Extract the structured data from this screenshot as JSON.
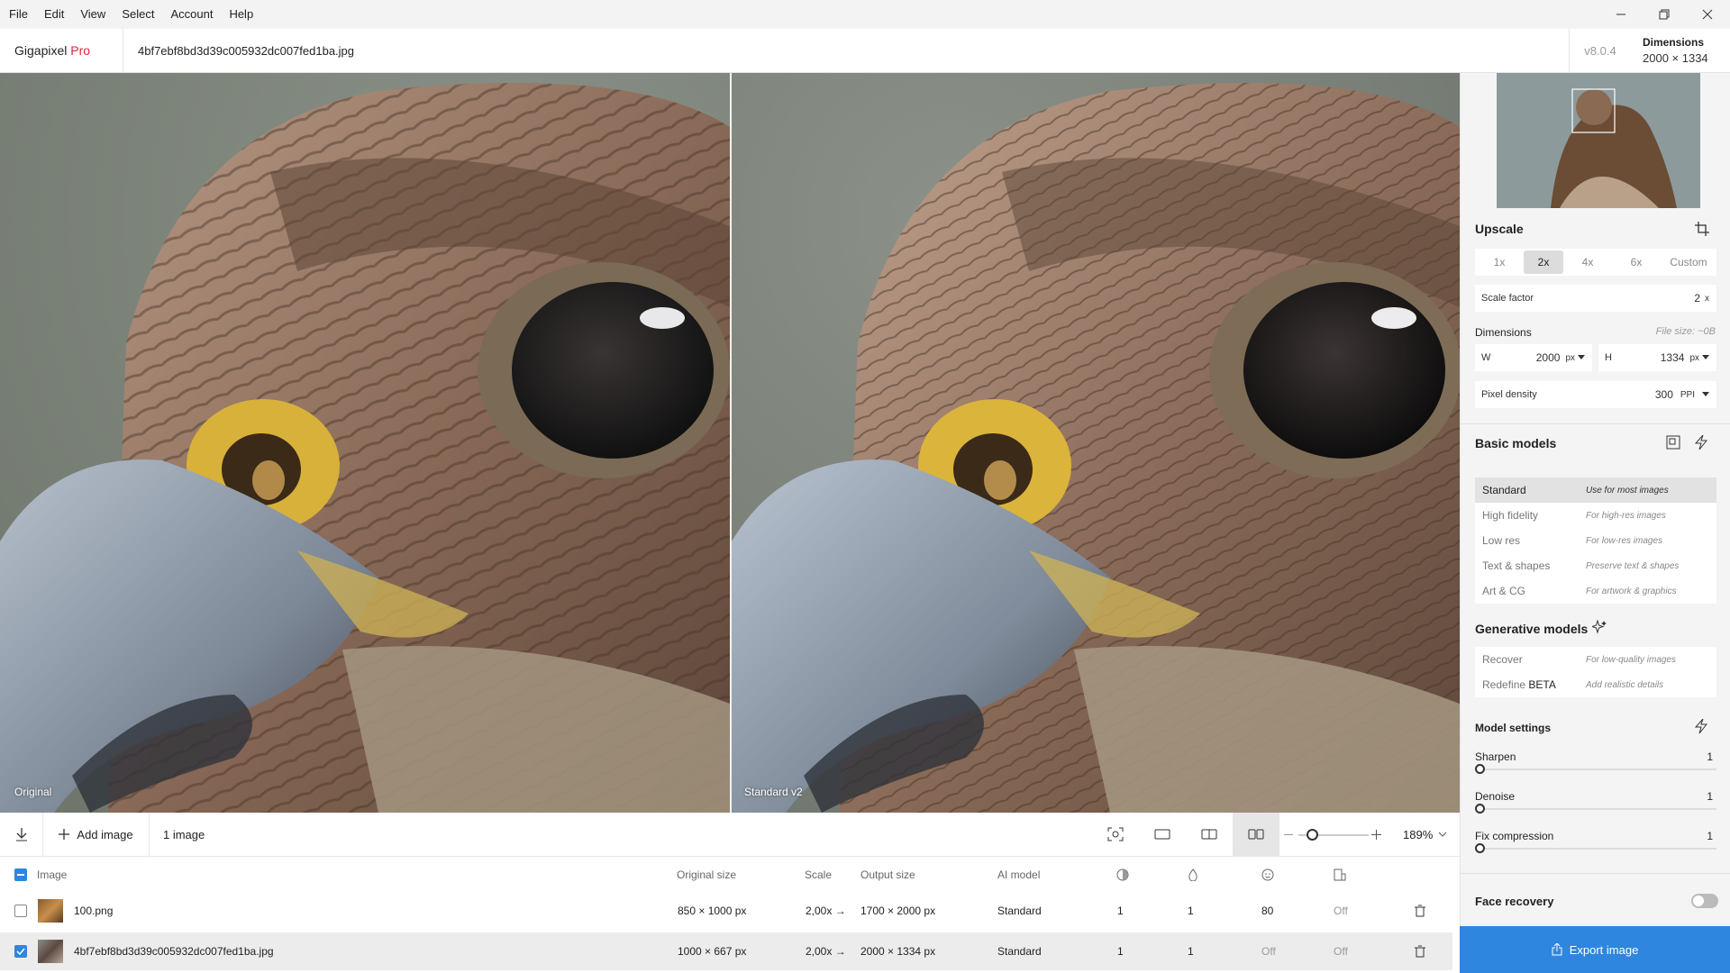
{
  "menu": [
    "File",
    "Edit",
    "View",
    "Select",
    "Account",
    "Help"
  ],
  "app": {
    "name": "Gigapixel",
    "edition": "Pro",
    "file": "4bf7ebf8bd3d39c005932dc007fed1ba.jpg",
    "version": "v8.0.4",
    "dims_label": "Dimensions",
    "dims_value": "2000 × 1334"
  },
  "canvas": {
    "left_label": "Original",
    "right_label": "Standard v2"
  },
  "toolbar": {
    "add_image": "Add image",
    "count": "1 image",
    "zoom": "189%"
  },
  "upscale": {
    "title": "Upscale",
    "options": [
      "1x",
      "2x",
      "4x",
      "6x",
      "Custom"
    ],
    "selected": "2x",
    "scale_label": "Scale factor",
    "scale_value": "2",
    "scale_unit": "x",
    "dims_label": "Dimensions",
    "file_size": "File size: ~0B",
    "w_label": "W",
    "w_value": "2000",
    "w_unit": "px",
    "h_label": "H",
    "h_value": "1334",
    "h_unit": "px",
    "density_label": "Pixel density",
    "density_value": "300",
    "density_unit": "PPI"
  },
  "basic_models": {
    "title": "Basic models",
    "items": [
      {
        "name": "Standard",
        "desc": "Use for most images"
      },
      {
        "name": "High fidelity",
        "desc": "For high-res images"
      },
      {
        "name": "Low res",
        "desc": "For low-res images"
      },
      {
        "name": "Text & shapes",
        "desc": "Preserve text & shapes"
      },
      {
        "name": "Art & CG",
        "desc": "For artwork & graphics"
      }
    ],
    "selected": "Standard"
  },
  "generative_models": {
    "title": "Generative models",
    "items": [
      {
        "name": "Recover",
        "desc": "For low-quality images"
      },
      {
        "name": "Redefine",
        "badge": "BETA",
        "desc": "Add realistic details"
      }
    ]
  },
  "model_settings": {
    "title": "Model settings",
    "sliders": [
      {
        "label": "Sharpen",
        "value": "1",
        "level": 0
      },
      {
        "label": "Denoise",
        "value": "1",
        "level": 0
      },
      {
        "label": "Fix compression",
        "value": "1",
        "level": 0
      }
    ]
  },
  "face_recovery": {
    "label": "Face recovery",
    "enabled": false
  },
  "export": {
    "label": "Export image"
  },
  "table": {
    "headers": {
      "image": "Image",
      "original": "Original size",
      "scale": "Scale",
      "output": "Output size",
      "model": "AI model"
    },
    "rows": [
      {
        "name": "100.png",
        "original": "850 × 1000 px",
        "scale": "2,00x",
        "output": "1700 × 2000 px",
        "model": "Standard",
        "c1": "1",
        "c2": "1",
        "c3": "80",
        "c4": "Off",
        "checked": false
      },
      {
        "name": "4bf7ebf8bd3d39c005932dc007fed1ba.jpg",
        "original": "1000 × 667 px",
        "scale": "2,00x",
        "output": "2000 × 1334 px",
        "model": "Standard",
        "c1": "1",
        "c2": "1",
        "c3": "Off",
        "c4": "Off",
        "checked": true
      }
    ]
  }
}
